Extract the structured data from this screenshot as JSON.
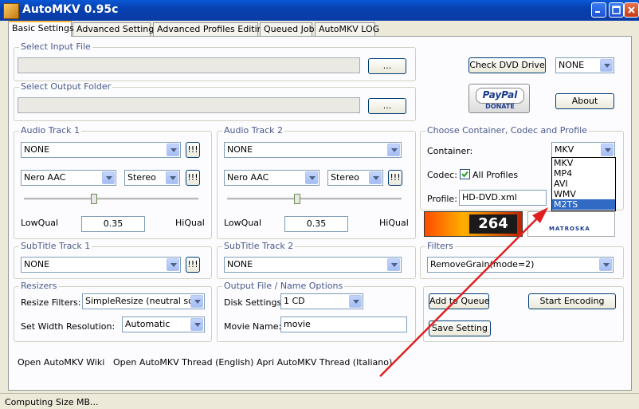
{
  "window": {
    "title": "AutoMKV 0.95c"
  },
  "tabs": [
    "Basic Settings",
    "Advanced Settings",
    "Advanced Profiles Editing",
    "Queued Job",
    "AutoMKV LOG"
  ],
  "input_file": {
    "label": "Select Input File",
    "browse": "..."
  },
  "output_folder": {
    "label": "Select Output Folder",
    "browse": "..."
  },
  "dvd": {
    "check_label": "Check DVD Drive",
    "drive_value": "NONE"
  },
  "paypal": {
    "brand": "PayPal",
    "sub": "DONATE"
  },
  "about_label": "About",
  "audio1": {
    "label": "Audio Track 1",
    "track": "NONE",
    "codec": "Nero AAC",
    "channels": "Stereo",
    "low": "LowQual",
    "high": "HiQual",
    "quality": "0.35",
    "slider_level": 0.4
  },
  "audio2": {
    "label": "Audio Track 2",
    "track": "NONE",
    "codec": "Nero AAC",
    "channels": "Stereo",
    "low": "LowQual",
    "high": "HiQual",
    "quality": "0.35",
    "slider_level": 0.4
  },
  "ellipsis_btn": "!!!",
  "container": {
    "group_label": "Choose Container, Codec and Profile",
    "container_label": "Container:",
    "container_value": "MKV",
    "codec_label": "Codec:",
    "all_profiles": "All Profiles",
    "all_profiles_checked": true,
    "profile_label": "Profile:",
    "profile_value": "HD-DVD.xml",
    "options": [
      "MKV",
      "MP4",
      "AVI",
      "WMV",
      "M2TS"
    ],
    "highlighted": "M2TS"
  },
  "logos": {
    "x264": "264",
    "matroska": "MATROSKA"
  },
  "subtitle1": {
    "label": "SubTitle Track 1",
    "value": "NONE"
  },
  "subtitle2": {
    "label": "SubTitle Track 2",
    "value": "NONE"
  },
  "filters": {
    "label": "Filters",
    "value": "RemoveGrain(mode=2)"
  },
  "resizers": {
    "label": "Resizers",
    "filter_label": "Resize Filters:",
    "filter_value": "SimpleResize (neutral soft)",
    "width_label": "Set Width Resolution:",
    "width_value": "Automatic"
  },
  "output": {
    "label": "Output File / Name Options",
    "disk_label": "Disk Settings:",
    "disk_value": "1 CD",
    "movie_label": "Movie Name:",
    "movie_value": "movie"
  },
  "actions": {
    "add_queue": "Add to Queue",
    "start": "Start Encoding",
    "save": "Save Setting"
  },
  "links": [
    "Open AutoMKV Wiki",
    "Open AutoMKV Thread (English)",
    "Apri AutoMKV Thread (Italiano)"
  ],
  "status": "Computing Size MB..."
}
